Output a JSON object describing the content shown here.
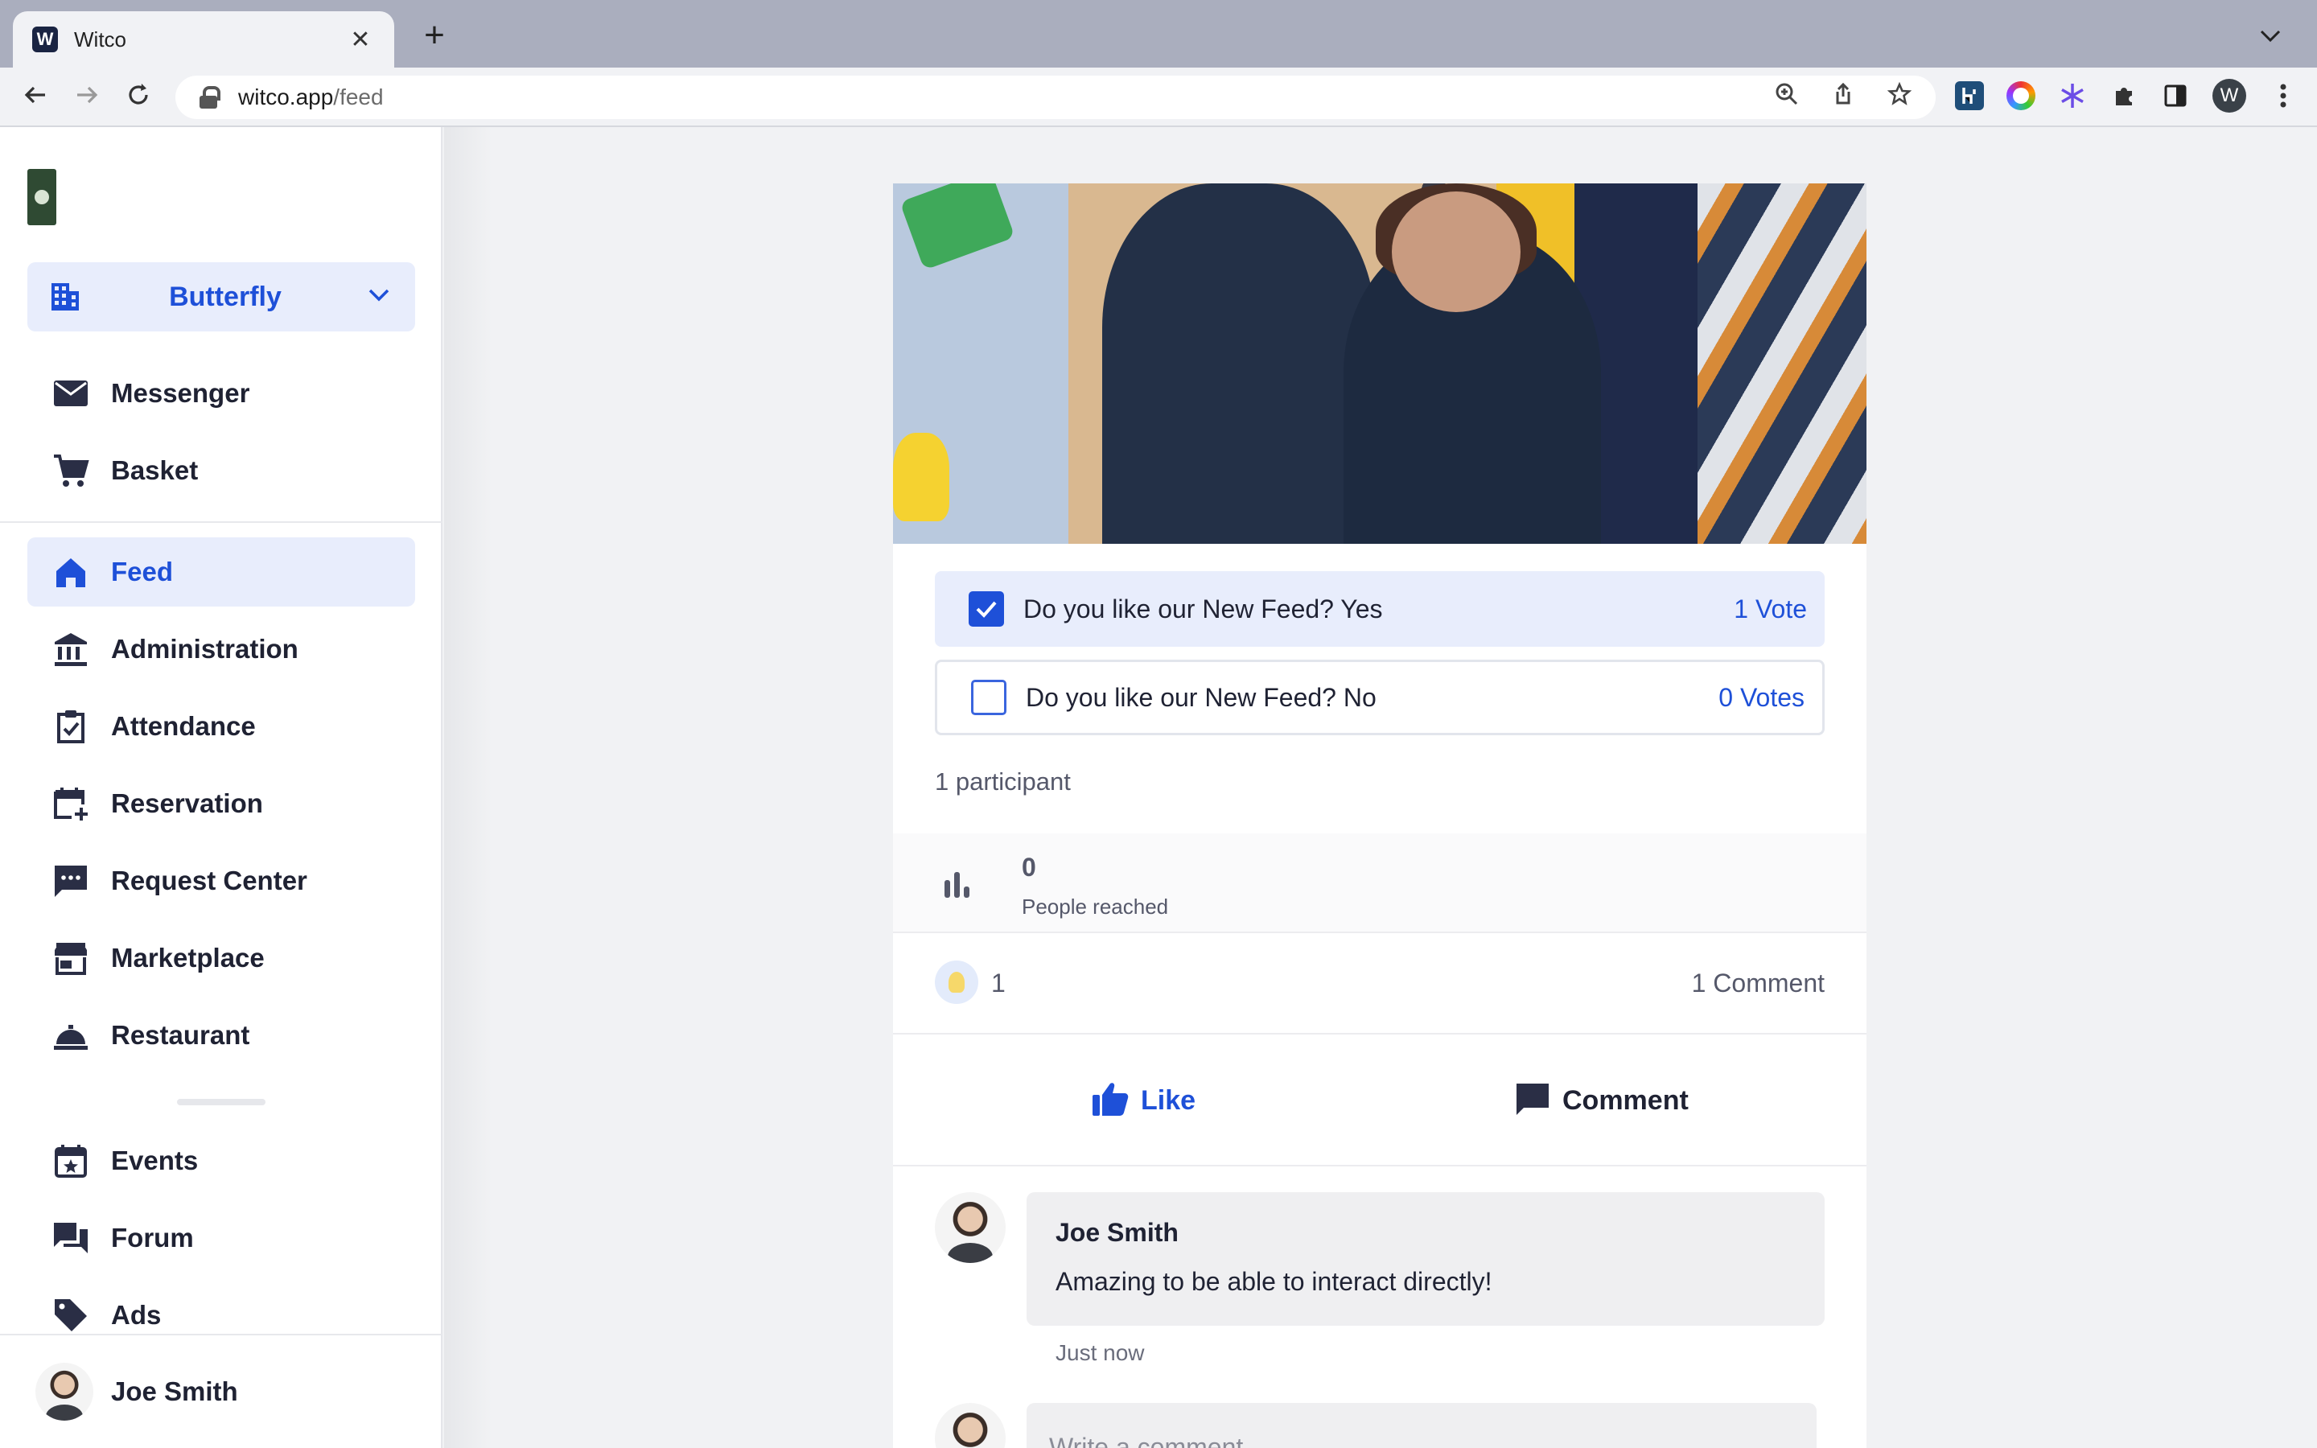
{
  "browser": {
    "tab_title": "Witco",
    "tab_favicon": "W",
    "close_glyph": "✕",
    "new_tab_glyph": "+",
    "url_host": "witco.app",
    "url_path": "/feed",
    "profile_initial": "W"
  },
  "sidebar": {
    "workspace": "Butterfly",
    "items": [
      {
        "label": "Messenger",
        "icon": "mail-icon"
      },
      {
        "label": "Basket",
        "icon": "cart-icon"
      },
      {
        "label": "Feed",
        "icon": "home-icon",
        "active": true
      },
      {
        "label": "Administration",
        "icon": "bank-icon"
      },
      {
        "label": "Attendance",
        "icon": "clipboard-check-icon"
      },
      {
        "label": "Reservation",
        "icon": "calendar-plus-icon"
      },
      {
        "label": "Request Center",
        "icon": "chat-dots-icon"
      },
      {
        "label": "Marketplace",
        "icon": "store-icon"
      },
      {
        "label": "Restaurant",
        "icon": "cloche-icon"
      },
      {
        "label": "Events",
        "icon": "calendar-star-icon"
      },
      {
        "label": "Forum",
        "icon": "forum-icon"
      },
      {
        "label": "Ads",
        "icon": "tag-icon"
      }
    ],
    "user_name": "Joe Smith"
  },
  "post": {
    "poll": [
      {
        "label": "Do you like our New Feed? Yes",
        "votes": "1 Vote",
        "checked": true
      },
      {
        "label": "Do you like our New Feed? No",
        "votes": "0 Votes",
        "checked": false
      }
    ],
    "participants": "1 participant",
    "reach_count": "0",
    "reach_label": "People reached",
    "reaction_count": "1",
    "comment_count": "1 Comment",
    "like_label": "Like",
    "comment_label": "Comment",
    "comments": [
      {
        "author": "Joe Smith",
        "text": "Amazing to be able to interact directly!",
        "time": "Just now"
      }
    ],
    "write_placeholder": "Write a comment"
  },
  "colors": {
    "accent": "#1e50d8",
    "accent_bg": "#e8edfc",
    "text": "#1f2233",
    "muted": "#55586a"
  }
}
